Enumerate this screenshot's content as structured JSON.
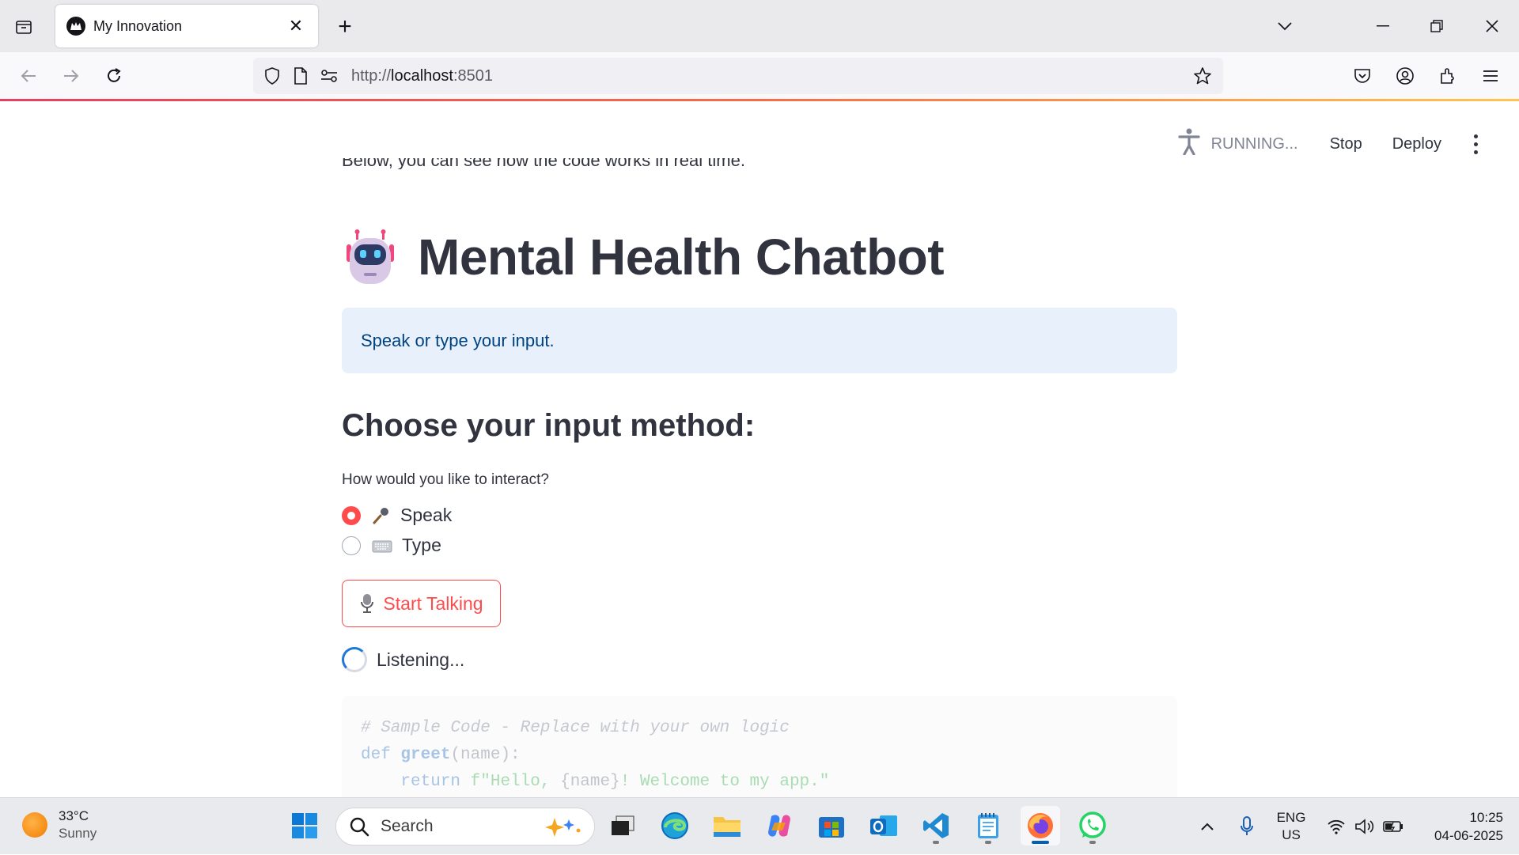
{
  "browser": {
    "tab_title": "My Innovation",
    "url_prefix": "http://",
    "url_host": "localhost",
    "url_port": ":8501"
  },
  "streamlit_header": {
    "status": "RUNNING...",
    "stop_label": "Stop",
    "deploy_label": "Deploy"
  },
  "main": {
    "cutoff_text": "Below, you can see how the code works in real time.",
    "title": "Mental Health Chatbot",
    "info": "Speak or type your input.",
    "subheader": "Choose your input method:",
    "radio_label": "How would you like to interact?",
    "options": [
      {
        "label": "Speak",
        "selected": true
      },
      {
        "label": "Type",
        "selected": false
      }
    ],
    "button_label": "Start Talking",
    "spinner_text": "Listening...",
    "code": {
      "comment": "# Sample Code - Replace with your own logic",
      "kw_def": "def",
      "fn_name": "greet",
      "params": "(name):",
      "kw_return": "return",
      "str_a": "f\"Hello, ",
      "brace_open": "{",
      "var": "name",
      "brace_close": "}",
      "str_b": "! Welcome to my app.\""
    }
  },
  "taskbar": {
    "temperature": "33°C",
    "condition": "Sunny",
    "search_placeholder": "Search",
    "lang_line1": "ENG",
    "lang_line2": "US",
    "time": "10:25",
    "date": "04-06-2025"
  },
  "colors": {
    "primary": "#ff4b4b",
    "info_bg": "#e8f1fb",
    "info_text": "#004280",
    "text": "#31333f"
  }
}
